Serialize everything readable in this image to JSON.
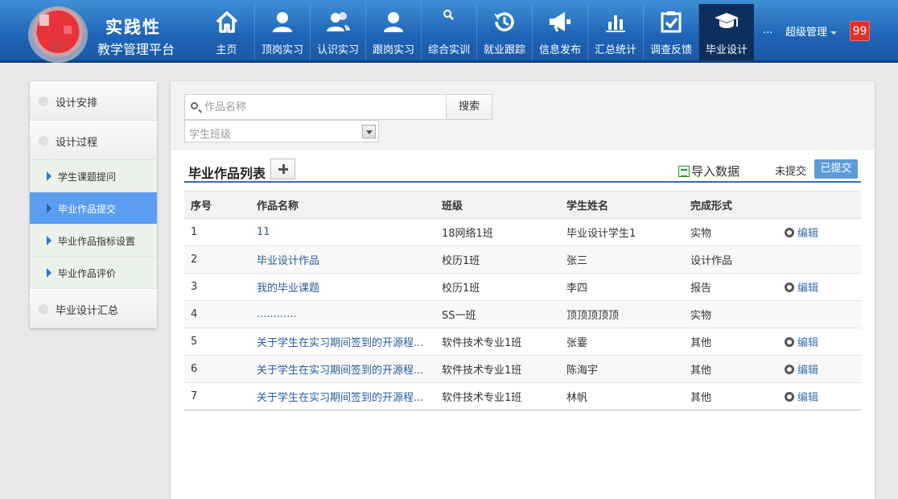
{
  "brand": {
    "title": "实践性",
    "subtitle": "教学管理平台"
  },
  "nav": {
    "items": [
      {
        "label": "主页",
        "icon": "home-icon"
      },
      {
        "label": "顶岗实习",
        "icon": "user-icon"
      },
      {
        "label": "认识实习",
        "icon": "users-icon"
      },
      {
        "label": "跟岗实习",
        "icon": "user-icon"
      },
      {
        "label": "综合实训",
        "icon": "search-icon"
      },
      {
        "label": "就业跟踪",
        "icon": "history-icon"
      },
      {
        "label": "信息发布",
        "icon": "megaphone-icon"
      },
      {
        "label": "汇总统计",
        "icon": "bar-chart-icon"
      },
      {
        "label": "调查反馈",
        "icon": "checkbox-icon"
      },
      {
        "label": "毕业设计",
        "icon": "graduation-cap-icon",
        "active": true
      }
    ],
    "more": "...",
    "user": "超级管理",
    "notifications": "99"
  },
  "sidebar": {
    "groups": [
      {
        "label": "设计安排"
      },
      {
        "label": "设计过程"
      }
    ],
    "subitems": [
      {
        "label": "学生课题提问"
      },
      {
        "label": "毕业作品提交",
        "active": true
      },
      {
        "label": "毕业作品指标设置"
      },
      {
        "label": "毕业作品评价"
      }
    ],
    "last_group": {
      "label": "毕业设计汇总"
    }
  },
  "filters": {
    "search_placeholder": "作品名称",
    "search_button": "搜索",
    "class_placeholder": "学生班级"
  },
  "list": {
    "title": "毕业作品列表",
    "import_label": "导入数据",
    "tab_unsubmitted": "未提交",
    "tab_submitted": "已提交",
    "columns": [
      "序号",
      "作品名称",
      "班级",
      "学生姓名",
      "完成形式",
      ""
    ],
    "edit_label": "编辑",
    "rows": [
      {
        "no": "1",
        "name": "11",
        "class": "18网络1班",
        "student": "毕业设计学生1",
        "form": "实物",
        "editable": true
      },
      {
        "no": "2",
        "name": "毕业设计作品",
        "class": "校历1班",
        "student": "张三",
        "form": "设计作品",
        "editable": false
      },
      {
        "no": "3",
        "name": "我的毕业课题",
        "class": "校历1班",
        "student": "李四",
        "form": "报告",
        "editable": true
      },
      {
        "no": "4",
        "name": "............",
        "class": "SS一班",
        "student": "顶顶顶顶顶",
        "form": "实物",
        "editable": false
      },
      {
        "no": "5",
        "name": "关于学生在实习期间签到的开源程...",
        "class": "软件技术专业1班",
        "student": "张霎",
        "form": "其他",
        "editable": true
      },
      {
        "no": "6",
        "name": "关于学生在实习期间签到的开源程...",
        "class": "软件技术专业1班",
        "student": "陈海宇",
        "form": "其他",
        "editable": true
      },
      {
        "no": "7",
        "name": "关于学生在实习期间签到的开源程...",
        "class": "软件技术专业1班",
        "student": "林帆",
        "form": "其他",
        "editable": true
      }
    ]
  },
  "colors": {
    "header": "#1f64b6",
    "nav_active": "#0d2f5e",
    "sidebar_active": "#5b9df0",
    "badge": "#e0302b",
    "tab_active": "#5b9bd8"
  }
}
